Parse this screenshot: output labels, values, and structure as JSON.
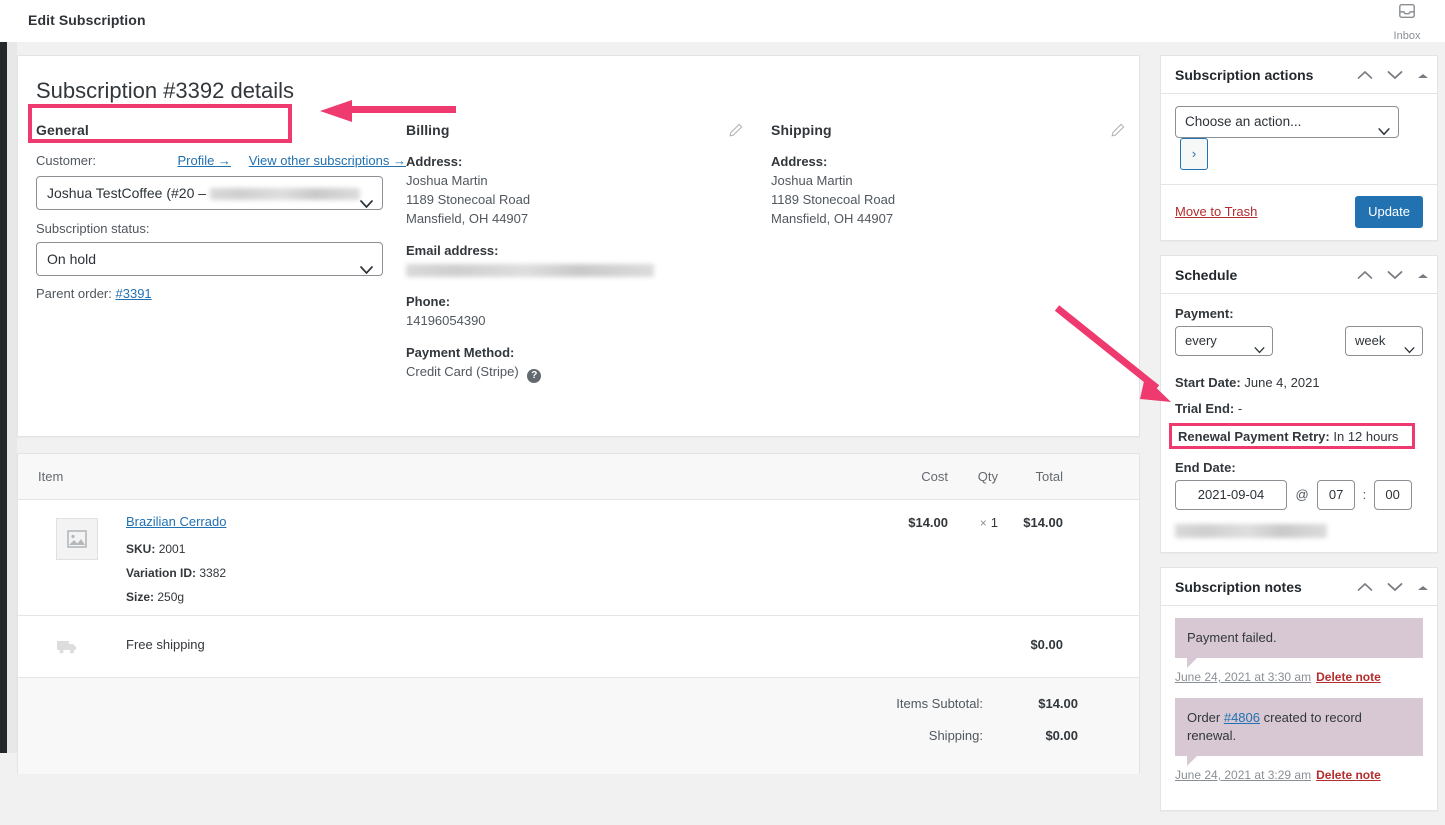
{
  "topbar": {
    "title": "Edit Subscription",
    "inbox_label": "Inbox"
  },
  "order": {
    "title": "Subscription #3392 details",
    "general": {
      "heading": "General",
      "customer_label": "Customer:",
      "profile_link": "Profile →",
      "other_subs_link": "View other subscriptions →",
      "customer_value": "Joshua TestCoffee (#20 – ",
      "status_label": "Subscription status:",
      "status_value": "On hold",
      "parent_order_label": "Parent order:",
      "parent_order_value": "#3391"
    },
    "billing": {
      "heading": "Billing",
      "address_label": "Address:",
      "address_line1": "Joshua Martin",
      "address_line2": "1189 Stonecoal Road",
      "address_line3": "Mansfield, OH 44907",
      "email_label": "Email address:",
      "phone_label": "Phone:",
      "phone_value": "14196054390",
      "payment_label": "Payment Method:",
      "payment_value": "Credit Card (Stripe)"
    },
    "shipping": {
      "heading": "Shipping",
      "address_label": "Address:",
      "address_line1": "Joshua Martin",
      "address_line2": "1189 Stonecoal Road",
      "address_line3": "Mansfield, OH 44907"
    }
  },
  "items": {
    "columns": {
      "item": "Item",
      "cost": "Cost",
      "qty": "Qty",
      "total": "Total"
    },
    "rows": [
      {
        "name": "Brazilian Cerrado",
        "sku_label": "SKU:",
        "sku_value": "2001",
        "variation_label": "Variation ID:",
        "variation_value": "3382",
        "size_label": "Size:",
        "size_value": "250g",
        "cost": "$14.00",
        "qty_symbol": "×",
        "qty": "1",
        "total": "$14.00"
      }
    ],
    "shipping_row": {
      "name": "Free shipping",
      "total": "$0.00"
    },
    "totals": [
      {
        "label": "Items Subtotal:",
        "value": "$14.00"
      },
      {
        "label": "Shipping:",
        "value": "$0.00"
      }
    ]
  },
  "sidebar": {
    "actions": {
      "heading": "Subscription actions",
      "select_value": "Choose an action...",
      "go_label": "›",
      "trash_label": "Move to Trash",
      "update_label": "Update"
    },
    "schedule": {
      "heading": "Schedule",
      "payment_label": "Payment:",
      "interval_value": "every",
      "period_value": "week",
      "start_date_label": "Start Date:",
      "start_date_value": "June 4, 2021",
      "trial_end_label": "Trial End:",
      "trial_end_value": "-",
      "retry_label": "Renewal Payment Retry:",
      "retry_value": "In 12 hours",
      "end_date_label": "End Date:",
      "end_date_value": "2021-09-04",
      "at_symbol": "@",
      "end_hour": "07",
      "time_colon": ":",
      "end_minute": "00"
    },
    "notes": {
      "heading": "Subscription notes",
      "items": [
        {
          "text": "Payment failed.",
          "link": "",
          "text_after": "",
          "date": "June 24, 2021 at 3:30 am",
          "delete_label": "Delete note"
        },
        {
          "text": "Order ",
          "link": "#4806",
          "text_after": " created to record renewal.",
          "date": "June 24, 2021 at 3:29 am",
          "delete_label": "Delete note"
        }
      ]
    }
  },
  "annotations": {
    "highlight_color": "#ee3a6e",
    "title_box": "Subscription #3392 details",
    "retry_box": "Renewal Payment Retry: In 12 hours"
  }
}
